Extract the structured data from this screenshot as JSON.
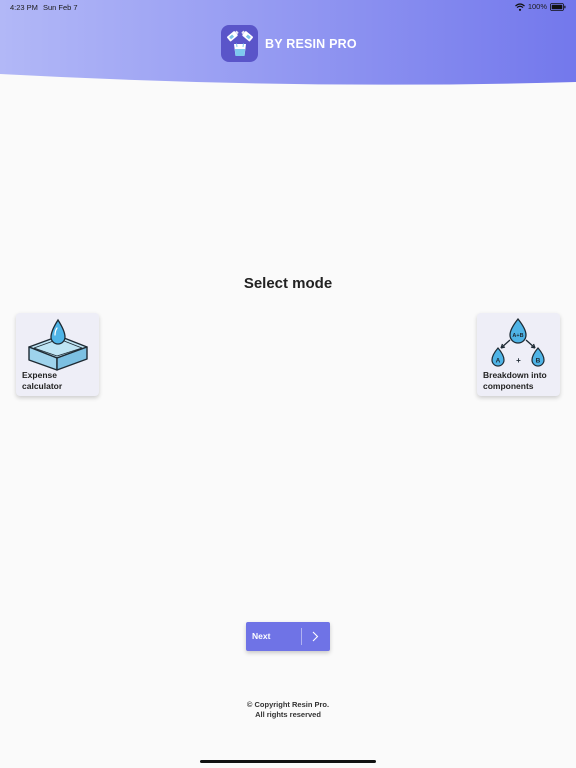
{
  "status_bar": {
    "time": "4:23 PM",
    "date": "Sun Feb 7",
    "battery": "100%"
  },
  "header": {
    "brand_name": "BY RESIN PRO",
    "logo_icon": "resin-cup-logo-icon",
    "gradient_start": "#b0b6f7",
    "gradient_end": "#7479ec"
  },
  "main": {
    "title": "Select mode",
    "modes": [
      {
        "label": "Expense calculator",
        "icon": "resin-box-icon"
      },
      {
        "label": "Breakdown into components",
        "icon": "components-split-icon",
        "icon_texts": {
          "mix": "A+B",
          "a": "A",
          "plus": "+",
          "b": "B"
        }
      }
    ]
  },
  "next_button": {
    "label": "Next",
    "icon": "chevron-right-icon",
    "color": "#6f73e6"
  },
  "footer": {
    "copyright": "© Copyright Resin Pro.",
    "rights": "All rights reserved"
  }
}
